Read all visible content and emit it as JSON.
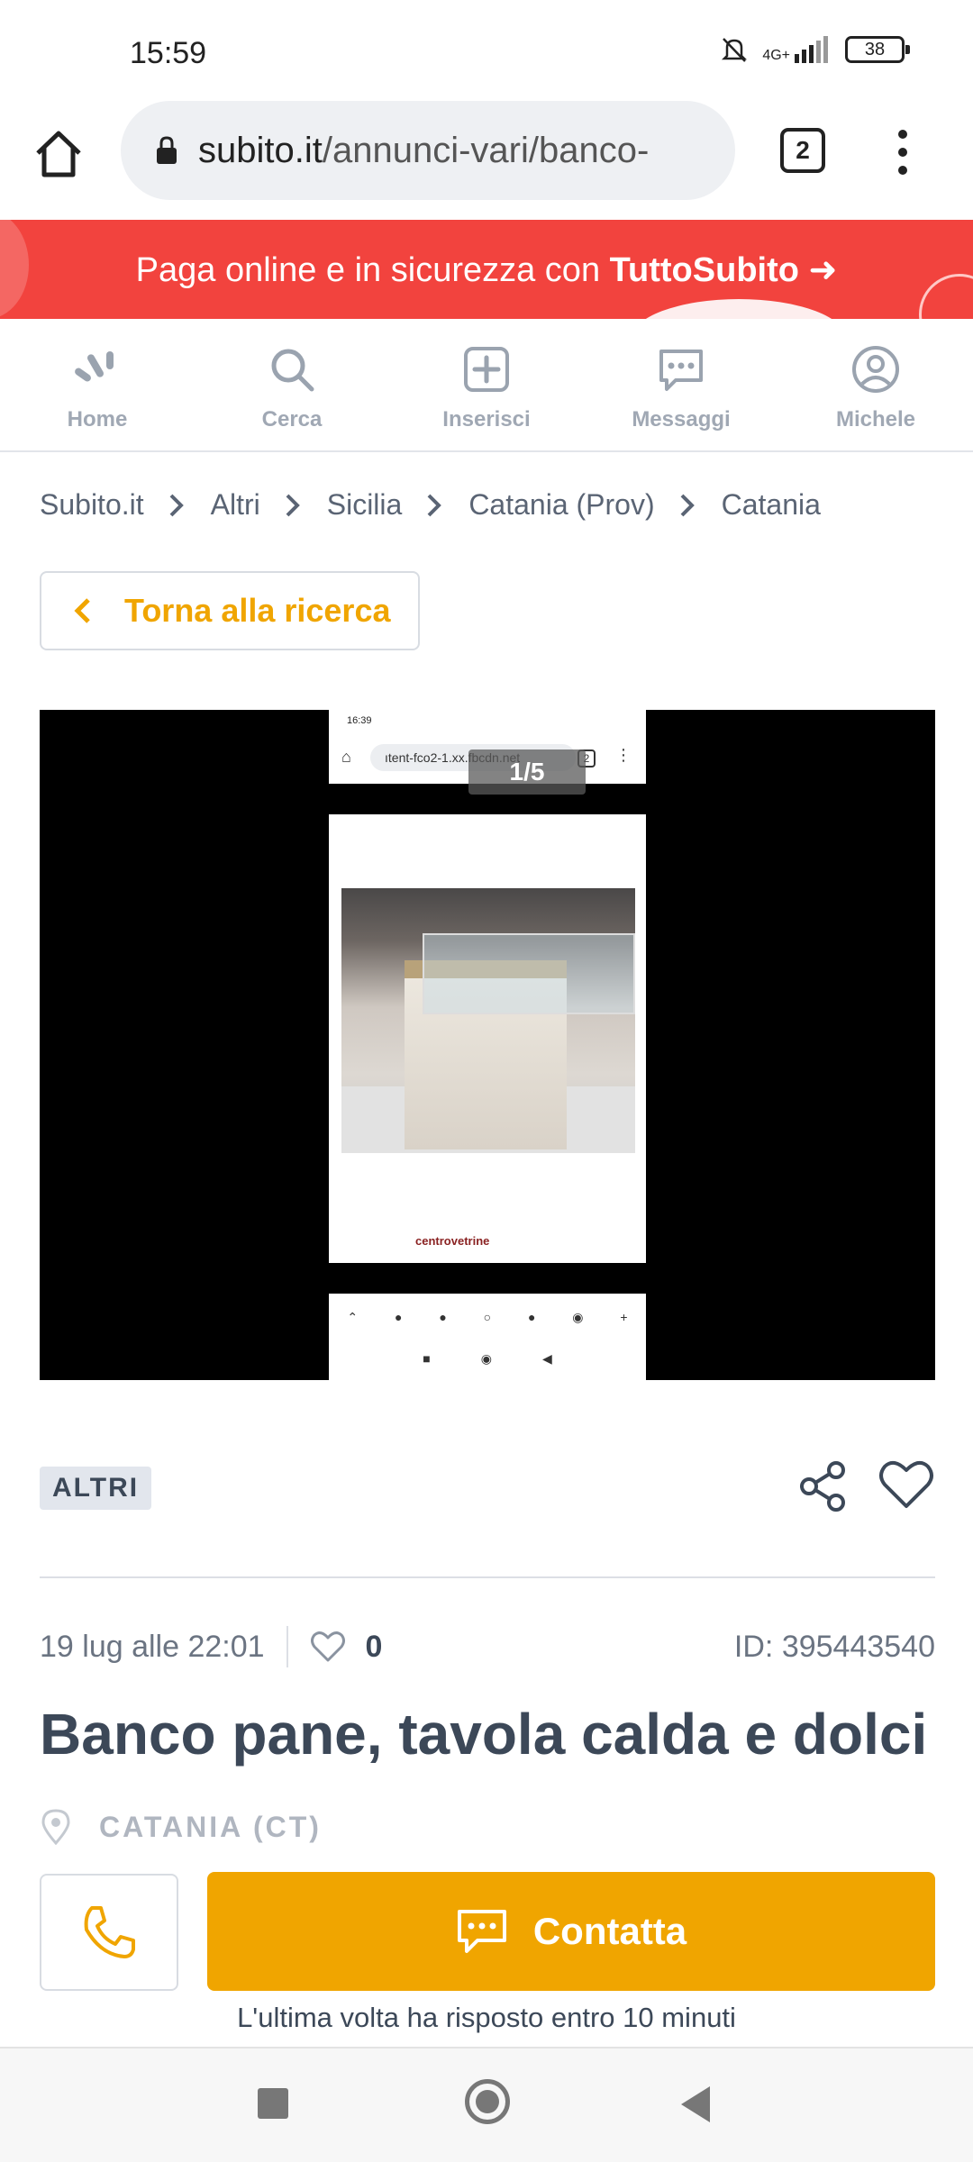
{
  "status_bar": {
    "time": "15:59",
    "network": "4G+",
    "battery": "38"
  },
  "browser": {
    "url_domain": "subito.it",
    "url_path": "/annunci-vari/banco-",
    "tab_count": "2"
  },
  "promo": {
    "text": "Paga online e in sicurezza con ",
    "brand": "TuttoSubito ➜"
  },
  "nav": {
    "items": [
      {
        "label": "Home",
        "icon": "home-icon"
      },
      {
        "label": "Cerca",
        "icon": "search-icon"
      },
      {
        "label": "Inserisci",
        "icon": "add-icon"
      },
      {
        "label": "Messaggi",
        "icon": "messages-icon"
      },
      {
        "label": "Michele",
        "icon": "user-icon"
      }
    ]
  },
  "breadcrumb": [
    "Subito.it",
    "Altri",
    "Sicilia",
    "Catania (Prov)",
    "Catania"
  ],
  "back_button": {
    "label": "Torna alla ricerca"
  },
  "gallery": {
    "counter": "1/5",
    "inner_time": "16:39",
    "inner_url": "ıtent-fco2-1.xx.fbcdn.net",
    "inner_tabs": "2",
    "inner_logo": "centrovetrine"
  },
  "listing": {
    "category": "ALTRI",
    "date": "19 lug alle 22:01",
    "favorites": "0",
    "id": "ID: 395443540",
    "title": "Banco pane, tavola calda e dolci",
    "location": "CATANIA (CT)"
  },
  "actions": {
    "contact_label": "Contatta",
    "reply_note": "L'ultima volta ha risposto entro 10 minuti"
  },
  "colors": {
    "accent": "#f0a500",
    "promo": "#f2433e",
    "text": "#3c4858"
  }
}
